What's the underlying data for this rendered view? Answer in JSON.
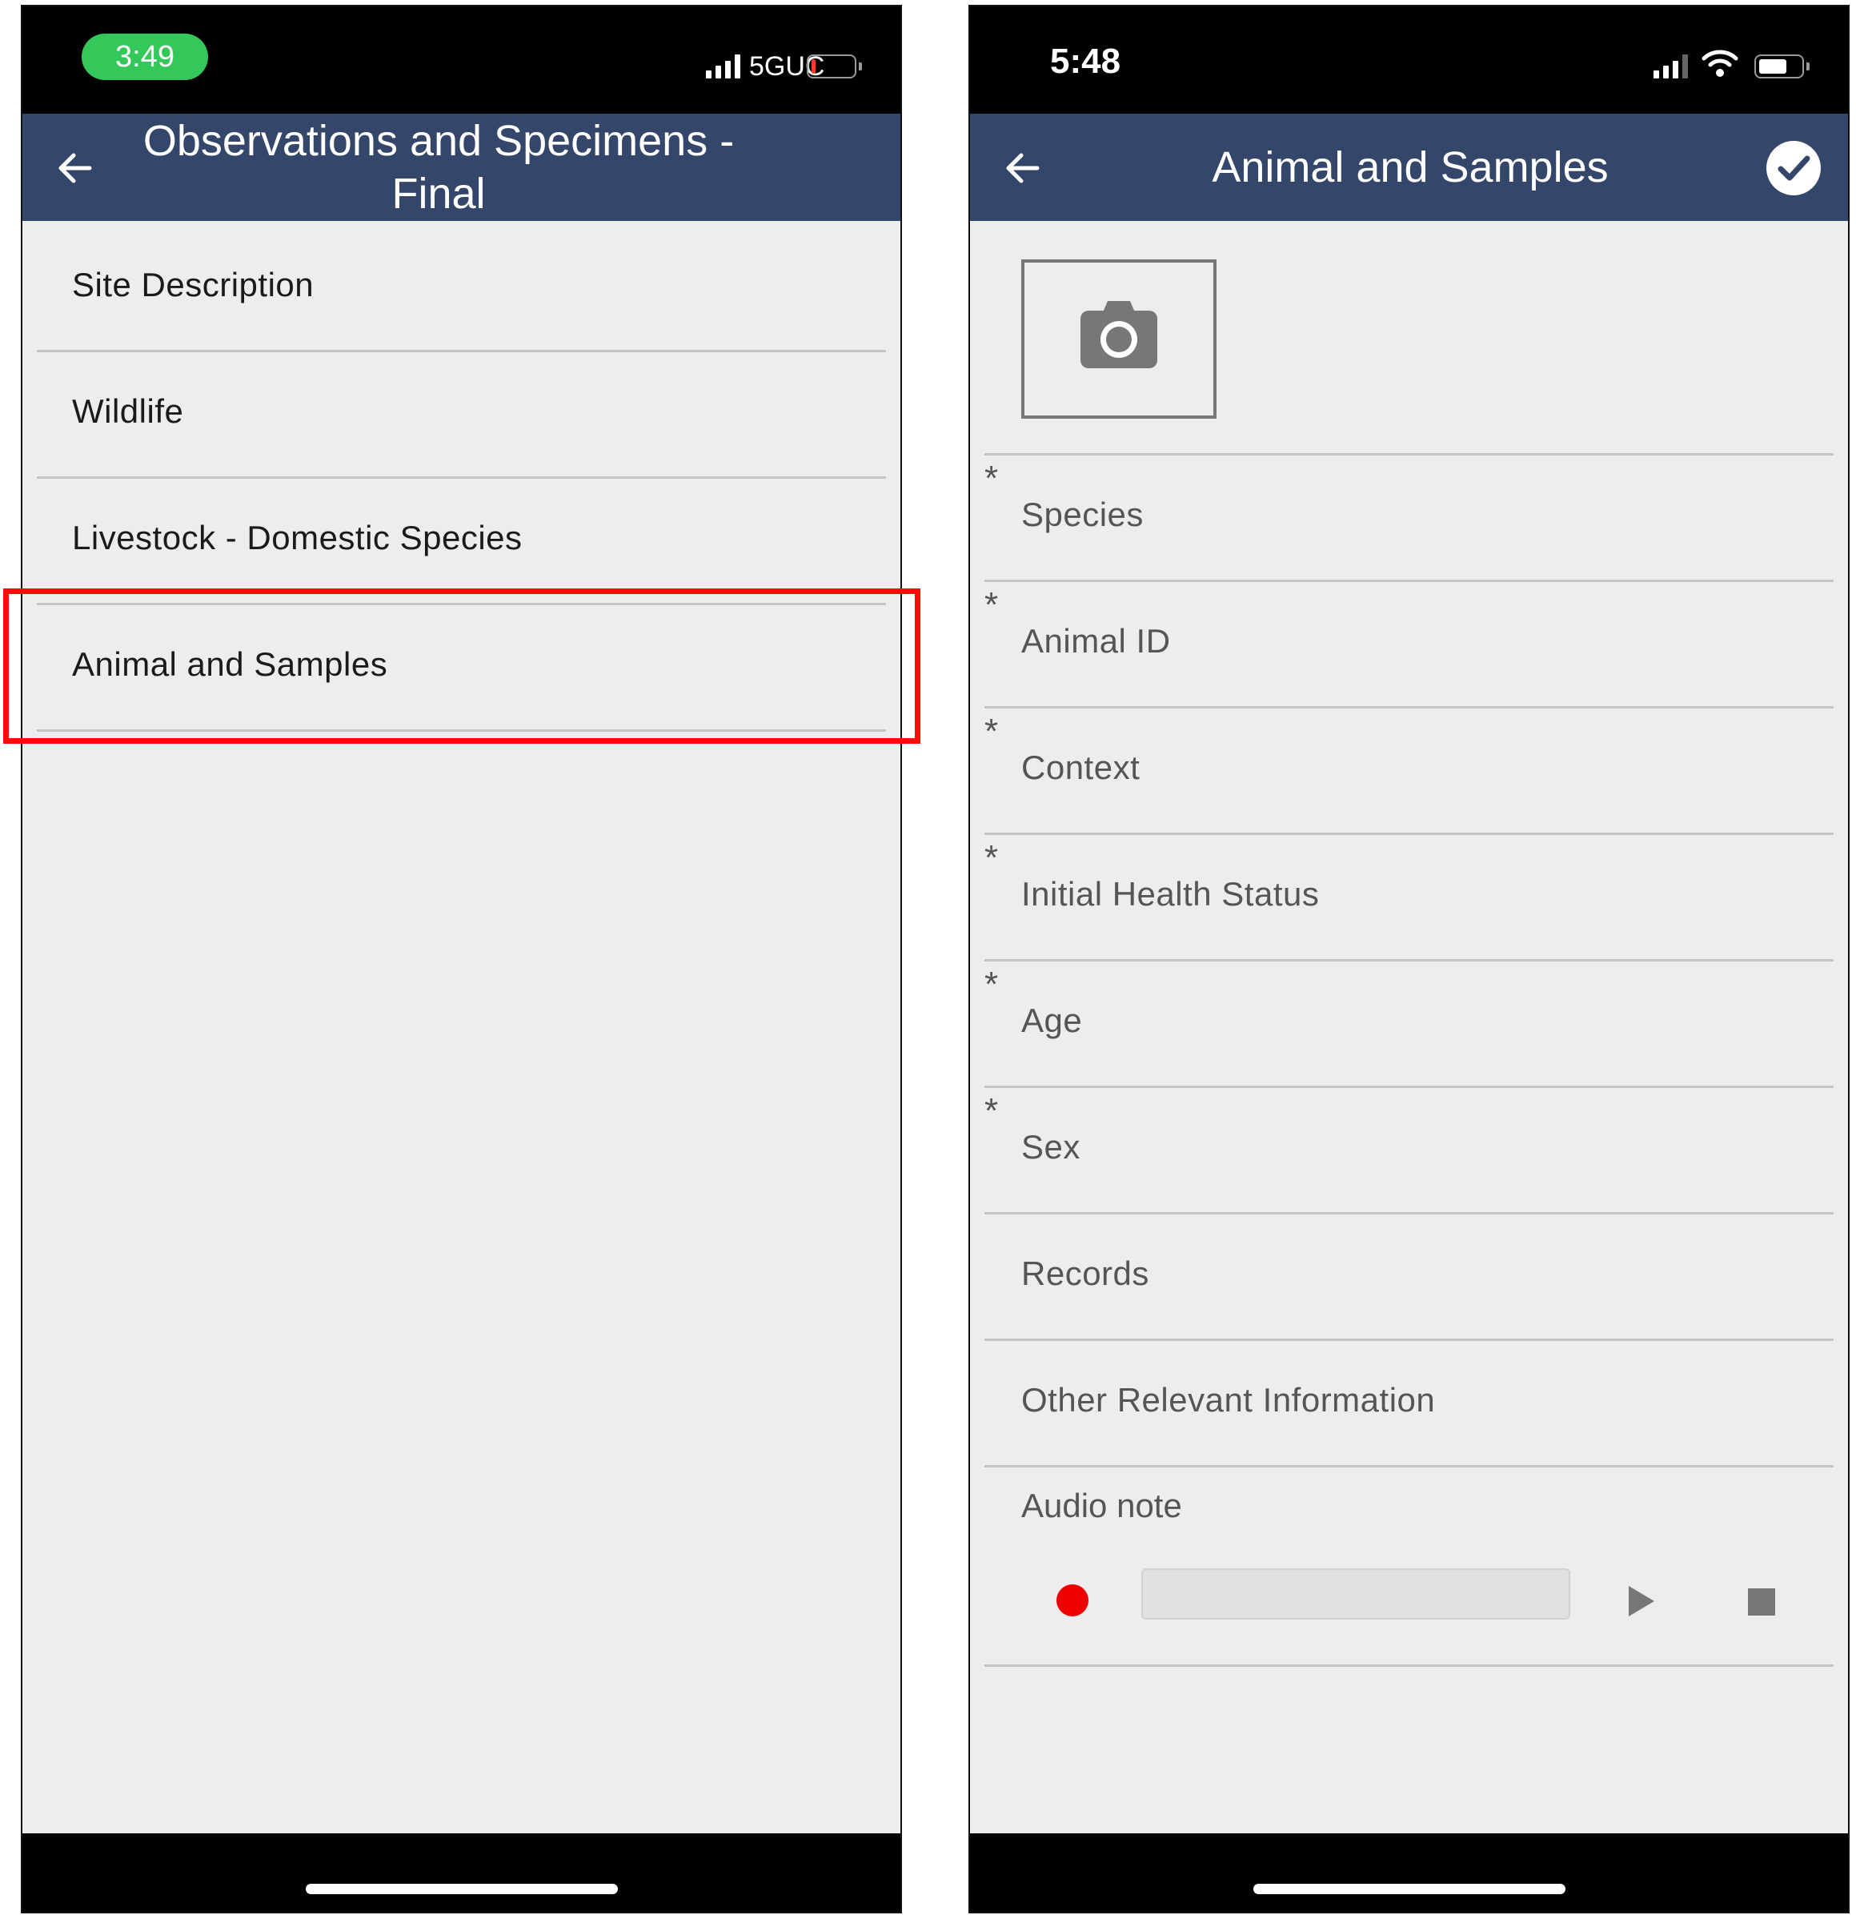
{
  "left_screen": {
    "status": {
      "time": "3:49",
      "network": "5GUC"
    },
    "appbar": {
      "title_line1": "Observations and Specimens -",
      "title_line2": "Final"
    },
    "menu_items": [
      {
        "label": "Site Description"
      },
      {
        "label": "Wildlife"
      },
      {
        "label": "Livestock - Domestic Species"
      },
      {
        "label": "Animal and Samples"
      }
    ],
    "highlighted_item": "Animal and Samples"
  },
  "right_screen": {
    "status": {
      "time": "5:48"
    },
    "appbar": {
      "title": "Animal and Samples"
    },
    "fields": [
      {
        "label": "Species",
        "required": "*"
      },
      {
        "label": "Animal ID",
        "required": "*"
      },
      {
        "label": "Context",
        "required": "*"
      },
      {
        "label": "Initial Health Status",
        "required": "*"
      },
      {
        "label": "Age",
        "required": "*"
      },
      {
        "label": "Sex",
        "required": "*"
      },
      {
        "label": "Records",
        "required": ""
      },
      {
        "label": "Other Relevant Information",
        "required": ""
      }
    ],
    "audio": {
      "label": "Audio note",
      "progress": 0
    }
  },
  "colors": {
    "appbar": "#34466a",
    "background": "#ededed",
    "time_pill": "#34c759",
    "highlight": "#ff0a0a",
    "record": "#ee0000",
    "low_battery": "#ff3b30"
  },
  "icons": [
    "back-arrow-icon",
    "checkmark-icon",
    "camera-icon",
    "signal-icon",
    "wifi-icon",
    "battery-icon",
    "record-icon",
    "play-icon",
    "stop-icon"
  ]
}
